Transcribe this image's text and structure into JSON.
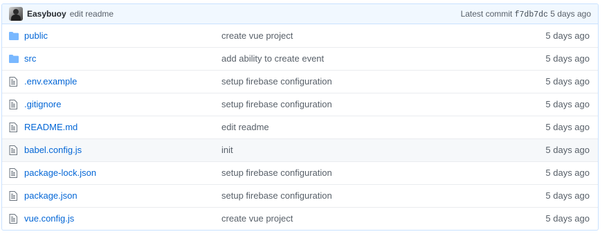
{
  "last_commit": {
    "author": "Easybuoy",
    "message": "edit readme",
    "latest_label": "Latest commit",
    "sha": "f7db7dc",
    "age": "5 days ago"
  },
  "colors": {
    "link": "#0366d6",
    "folder_icon": "#79b8ff",
    "header_bg": "#f1f8ff",
    "muted_text": "#586069"
  },
  "files": [
    {
      "type": "folder",
      "icon": "folder-icon",
      "name": "public",
      "message": "create vue project",
      "age": "5 days ago"
    },
    {
      "type": "folder",
      "icon": "folder-icon",
      "name": "src",
      "message": "add ability to create event",
      "age": "5 days ago"
    },
    {
      "type": "file",
      "icon": "file-icon",
      "name": ".env.example",
      "message": "setup firebase configuration",
      "age": "5 days ago"
    },
    {
      "type": "file",
      "icon": "file-icon",
      "name": ".gitignore",
      "message": "setup firebase configuration",
      "age": "5 days ago"
    },
    {
      "type": "file",
      "icon": "file-icon",
      "name": "README.md",
      "message": "edit readme",
      "age": "5 days ago"
    },
    {
      "type": "file",
      "icon": "file-icon",
      "name": "babel.config.js",
      "message": "init",
      "age": "5 days ago"
    },
    {
      "type": "file",
      "icon": "file-icon",
      "name": "package-lock.json",
      "message": "setup firebase configuration",
      "age": "5 days ago"
    },
    {
      "type": "file",
      "icon": "file-icon",
      "name": "package.json",
      "message": "setup firebase configuration",
      "age": "5 days ago"
    },
    {
      "type": "file",
      "icon": "file-icon",
      "name": "vue.config.js",
      "message": "create vue project",
      "age": "5 days ago"
    }
  ]
}
